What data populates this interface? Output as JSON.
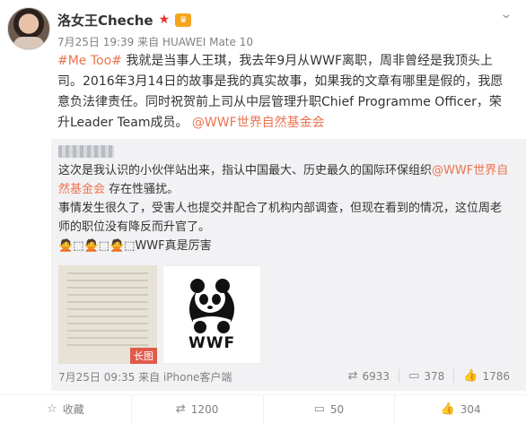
{
  "author": {
    "name": "洛女王Cheche",
    "meta": "7月25日 19:39 来自 HUAWEI Mate 10"
  },
  "content": {
    "hashtag": "#Me Too#",
    "text": " 我就是当事人王琪，我去年9月从WWF离职，周非曾经是我顶头上司。2016年3月14日的故事是我的真实故事，如果我的文章有哪里是假的，我愿意负法律责任。同时祝贺前上司从中层管理升职Chief Programme Officer，荣升Leader Team成员。 ",
    "mention": "@WWF世界自然基金会"
  },
  "repost": {
    "text_1": "这次是我认识的小伙伴站出来，指认中国最大、历史最久的国际环保组织",
    "mention": "@WWF世界自然基金会",
    "text_2": " 存在性骚扰。",
    "text_3": "事情发生很久了，受害人也提交并配合了机构内部调查，但现在看到的情况，这位周老师的职位没有降反而升官了。",
    "text_4": "WWF真是厉害",
    "long_image_badge": "长图",
    "wwf_logo_text": "WWF",
    "time": "7月25日 09:35 来自 iPhone客户端",
    "stats": {
      "reposts": "6933",
      "comments": "378",
      "likes": "1786"
    }
  },
  "actions": {
    "favorite": "收藏",
    "repost": "1200",
    "comment": "50",
    "like": "304"
  },
  "icons": {
    "more": "chevron-down-icon",
    "vip": "star-icon",
    "badge": "crown-badge-icon",
    "repost": "repost-icon",
    "comment": "comment-icon",
    "like": "thumbs-up-icon",
    "favorite": "star-outline-icon"
  },
  "colors": {
    "link": "#eb7350",
    "repost_bg": "#f2f2f5",
    "meta_text": "#808080"
  }
}
